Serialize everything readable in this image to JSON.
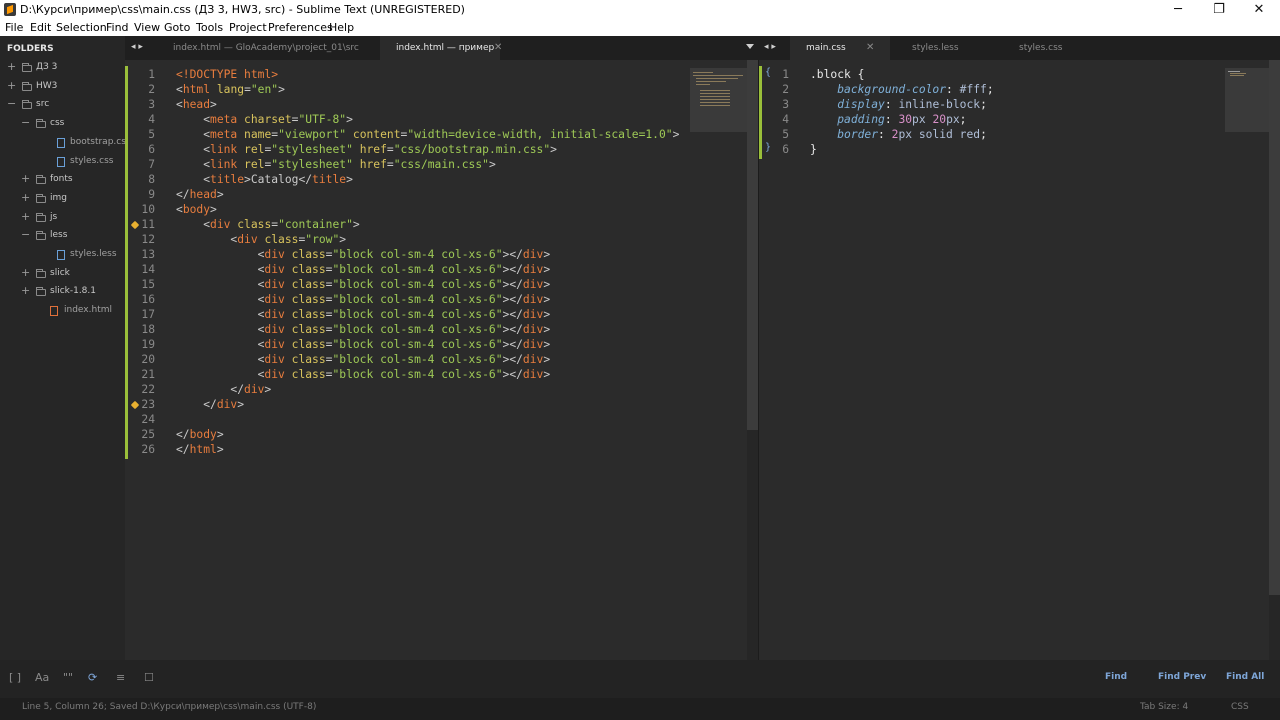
{
  "window": {
    "title": "D:\\Курси\\пример\\css\\main.css (ДЗ 3, HW3, src) - Sublime Text (UNREGISTERED)",
    "minimize": "─",
    "maximize": "❐",
    "close": "✕"
  },
  "menu": [
    "File",
    "Edit",
    "Selection",
    "Find",
    "View",
    "Goto",
    "Tools",
    "Project",
    "Preferences",
    "Help"
  ],
  "sidebar": {
    "header": "FOLDERS",
    "items": [
      {
        "label": "ДЗ 3",
        "type": "folder",
        "depth": 0,
        "toggle": "+"
      },
      {
        "label": "HW3",
        "type": "folder",
        "depth": 0,
        "toggle": "+"
      },
      {
        "label": "src",
        "type": "folder",
        "depth": 0,
        "toggle": "−"
      },
      {
        "label": "css",
        "type": "folder",
        "depth": 1,
        "toggle": "−"
      },
      {
        "label": "bootstrap.css",
        "type": "file",
        "depth": 2,
        "toggle": ""
      },
      {
        "label": "styles.css",
        "type": "file",
        "depth": 2,
        "toggle": ""
      },
      {
        "label": "fonts",
        "type": "folder",
        "depth": 1,
        "toggle": "+"
      },
      {
        "label": "img",
        "type": "folder",
        "depth": 1,
        "toggle": "+"
      },
      {
        "label": "js",
        "type": "folder",
        "depth": 1,
        "toggle": "+"
      },
      {
        "label": "less",
        "type": "folder",
        "depth": 1,
        "toggle": "−"
      },
      {
        "label": "styles.less",
        "type": "file",
        "depth": 2,
        "toggle": ""
      },
      {
        "label": "slick",
        "type": "folder",
        "depth": 1,
        "toggle": "+"
      },
      {
        "label": "slick-1.8.1",
        "type": "folder",
        "depth": 1,
        "toggle": "+"
      },
      {
        "label": "index.html",
        "type": "htmlfile",
        "depth": 1,
        "toggle": ""
      }
    ]
  },
  "left_pane": {
    "nav": "◂ ▸",
    "tabs": [
      {
        "label": "index.html — GloAcademy\\project_01\\src",
        "active": false
      },
      {
        "label": "index.html — пример",
        "active": true,
        "close": "✕"
      }
    ],
    "lines": [
      {
        "n": "1",
        "tokens": [
          [
            "t-doc",
            "<!DOCTYPE "
          ],
          [
            "t-tag",
            "html"
          ],
          [
            "t-doc",
            ">"
          ]
        ]
      },
      {
        "n": "2",
        "tokens": [
          [
            "t-punc",
            "<"
          ],
          [
            "t-tag",
            "html"
          ],
          [
            "t-punc",
            " "
          ],
          [
            "t-attr",
            "lang"
          ],
          [
            "t-punc",
            "="
          ],
          [
            "t-str",
            "\"en\""
          ],
          [
            "t-punc",
            ">"
          ]
        ]
      },
      {
        "n": "3",
        "tokens": [
          [
            "t-punc",
            "<"
          ],
          [
            "t-tag",
            "head"
          ],
          [
            "t-punc",
            ">"
          ]
        ]
      },
      {
        "n": "4",
        "tokens": [
          [
            "t-punc",
            "    <"
          ],
          [
            "t-tag",
            "meta"
          ],
          [
            "t-punc",
            " "
          ],
          [
            "t-attr",
            "charset"
          ],
          [
            "t-punc",
            "="
          ],
          [
            "t-str",
            "\"UTF-8\""
          ],
          [
            "t-punc",
            ">"
          ]
        ]
      },
      {
        "n": "5",
        "tokens": [
          [
            "t-punc",
            "    <"
          ],
          [
            "t-tag",
            "meta"
          ],
          [
            "t-punc",
            " "
          ],
          [
            "t-attr",
            "name"
          ],
          [
            "t-punc",
            "="
          ],
          [
            "t-str",
            "\"viewport\""
          ],
          [
            "t-punc",
            " "
          ],
          [
            "t-attr",
            "content"
          ],
          [
            "t-punc",
            "="
          ],
          [
            "t-str",
            "\"width=device-width, initial-scale=1.0\""
          ],
          [
            "t-punc",
            ">"
          ]
        ]
      },
      {
        "n": "6",
        "tokens": [
          [
            "t-punc",
            "    <"
          ],
          [
            "t-tag",
            "link"
          ],
          [
            "t-punc",
            " "
          ],
          [
            "t-attr",
            "rel"
          ],
          [
            "t-punc",
            "="
          ],
          [
            "t-str",
            "\"stylesheet\""
          ],
          [
            "t-punc",
            " "
          ],
          [
            "t-attr",
            "href"
          ],
          [
            "t-punc",
            "="
          ],
          [
            "t-str",
            "\"css/bootstrap.min.css\""
          ],
          [
            "t-punc",
            ">"
          ]
        ]
      },
      {
        "n": "7",
        "tokens": [
          [
            "t-punc",
            "    <"
          ],
          [
            "t-tag",
            "link"
          ],
          [
            "t-punc",
            " "
          ],
          [
            "t-attr",
            "rel"
          ],
          [
            "t-punc",
            "="
          ],
          [
            "t-str",
            "\"stylesheet\""
          ],
          [
            "t-punc",
            " "
          ],
          [
            "t-attr",
            "href"
          ],
          [
            "t-punc",
            "="
          ],
          [
            "t-str",
            "\"css/main.css\""
          ],
          [
            "t-punc",
            ">"
          ]
        ]
      },
      {
        "n": "8",
        "tokens": [
          [
            "t-punc",
            "    <"
          ],
          [
            "t-tag",
            "title"
          ],
          [
            "t-punc",
            ">Catalog</"
          ],
          [
            "t-tag",
            "title"
          ],
          [
            "t-punc",
            ">"
          ]
        ]
      },
      {
        "n": "9",
        "tokens": [
          [
            "t-punc",
            "</"
          ],
          [
            "t-tag",
            "head"
          ],
          [
            "t-punc",
            ">"
          ]
        ]
      },
      {
        "n": "10",
        "tokens": [
          [
            "t-punc",
            "<"
          ],
          [
            "t-tag",
            "body"
          ],
          [
            "t-punc",
            ">"
          ]
        ]
      },
      {
        "n": "11",
        "marker": true,
        "tokens": [
          [
            "t-punc",
            "    <"
          ],
          [
            "t-tag",
            "div"
          ],
          [
            "t-punc",
            " "
          ],
          [
            "t-attr",
            "class"
          ],
          [
            "t-punc",
            "="
          ],
          [
            "t-str",
            "\"container\""
          ],
          [
            "t-punc",
            ">"
          ]
        ]
      },
      {
        "n": "12",
        "tokens": [
          [
            "t-punc",
            "        <"
          ],
          [
            "t-tag",
            "div"
          ],
          [
            "t-punc",
            " "
          ],
          [
            "t-attr",
            "class"
          ],
          [
            "t-punc",
            "="
          ],
          [
            "t-str",
            "\"row\""
          ],
          [
            "t-punc",
            ">"
          ]
        ]
      },
      {
        "n": "13",
        "tokens": [
          [
            "t-punc",
            "            <"
          ],
          [
            "t-tag",
            "div"
          ],
          [
            "t-punc",
            " "
          ],
          [
            "t-attr",
            "class"
          ],
          [
            "t-punc",
            "="
          ],
          [
            "t-str",
            "\"block col-sm-4 col-xs-6\""
          ],
          [
            "t-punc",
            "></"
          ],
          [
            "t-tag",
            "div"
          ],
          [
            "t-punc",
            ">"
          ]
        ]
      },
      {
        "n": "14",
        "tokens": [
          [
            "t-punc",
            "            <"
          ],
          [
            "t-tag",
            "div"
          ],
          [
            "t-punc",
            " "
          ],
          [
            "t-attr",
            "class"
          ],
          [
            "t-punc",
            "="
          ],
          [
            "t-str",
            "\"block col-sm-4 col-xs-6\""
          ],
          [
            "t-punc",
            "></"
          ],
          [
            "t-tag",
            "div"
          ],
          [
            "t-punc",
            ">"
          ]
        ]
      },
      {
        "n": "15",
        "tokens": [
          [
            "t-punc",
            "            <"
          ],
          [
            "t-tag",
            "div"
          ],
          [
            "t-punc",
            " "
          ],
          [
            "t-attr",
            "class"
          ],
          [
            "t-punc",
            "="
          ],
          [
            "t-str",
            "\"block col-sm-4 col-xs-6\""
          ],
          [
            "t-punc",
            "></"
          ],
          [
            "t-tag",
            "div"
          ],
          [
            "t-punc",
            ">"
          ]
        ]
      },
      {
        "n": "16",
        "tokens": [
          [
            "t-punc",
            "            <"
          ],
          [
            "t-tag",
            "div"
          ],
          [
            "t-punc",
            " "
          ],
          [
            "t-attr",
            "class"
          ],
          [
            "t-punc",
            "="
          ],
          [
            "t-str",
            "\"block col-sm-4 col-xs-6\""
          ],
          [
            "t-punc",
            "></"
          ],
          [
            "t-tag",
            "div"
          ],
          [
            "t-punc",
            ">"
          ]
        ]
      },
      {
        "n": "17",
        "tokens": [
          [
            "t-punc",
            "            <"
          ],
          [
            "t-tag",
            "div"
          ],
          [
            "t-punc",
            " "
          ],
          [
            "t-attr",
            "class"
          ],
          [
            "t-punc",
            "="
          ],
          [
            "t-str",
            "\"block col-sm-4 col-xs-6\""
          ],
          [
            "t-punc",
            "></"
          ],
          [
            "t-tag",
            "div"
          ],
          [
            "t-punc",
            ">"
          ]
        ]
      },
      {
        "n": "18",
        "tokens": [
          [
            "t-punc",
            "            <"
          ],
          [
            "t-tag",
            "div"
          ],
          [
            "t-punc",
            " "
          ],
          [
            "t-attr",
            "class"
          ],
          [
            "t-punc",
            "="
          ],
          [
            "t-str",
            "\"block col-sm-4 col-xs-6\""
          ],
          [
            "t-punc",
            "></"
          ],
          [
            "t-tag",
            "div"
          ],
          [
            "t-punc",
            ">"
          ]
        ]
      },
      {
        "n": "19",
        "tokens": [
          [
            "t-punc",
            "            <"
          ],
          [
            "t-tag",
            "div"
          ],
          [
            "t-punc",
            " "
          ],
          [
            "t-attr",
            "class"
          ],
          [
            "t-punc",
            "="
          ],
          [
            "t-str",
            "\"block col-sm-4 col-xs-6\""
          ],
          [
            "t-punc",
            "></"
          ],
          [
            "t-tag",
            "div"
          ],
          [
            "t-punc",
            ">"
          ]
        ]
      },
      {
        "n": "20",
        "tokens": [
          [
            "t-punc",
            "            <"
          ],
          [
            "t-tag",
            "div"
          ],
          [
            "t-punc",
            " "
          ],
          [
            "t-attr",
            "class"
          ],
          [
            "t-punc",
            "="
          ],
          [
            "t-str",
            "\"block col-sm-4 col-xs-6\""
          ],
          [
            "t-punc",
            "></"
          ],
          [
            "t-tag",
            "div"
          ],
          [
            "t-punc",
            ">"
          ]
        ]
      },
      {
        "n": "21",
        "tokens": [
          [
            "t-punc",
            "            <"
          ],
          [
            "t-tag",
            "div"
          ],
          [
            "t-punc",
            " "
          ],
          [
            "t-attr",
            "class"
          ],
          [
            "t-punc",
            "="
          ],
          [
            "t-str",
            "\"block col-sm-4 col-xs-6\""
          ],
          [
            "t-punc",
            "></"
          ],
          [
            "t-tag",
            "div"
          ],
          [
            "t-punc",
            ">"
          ]
        ]
      },
      {
        "n": "22",
        "tokens": [
          [
            "t-punc",
            "        </"
          ],
          [
            "t-tag",
            "div"
          ],
          [
            "t-punc",
            ">"
          ]
        ]
      },
      {
        "n": "23",
        "marker": true,
        "tokens": [
          [
            "t-punc",
            "    </"
          ],
          [
            "t-tag",
            "div"
          ],
          [
            "t-punc",
            ">"
          ]
        ]
      },
      {
        "n": "24",
        "tokens": []
      },
      {
        "n": "25",
        "tokens": [
          [
            "t-punc",
            "</"
          ],
          [
            "t-tag",
            "body"
          ],
          [
            "t-punc",
            ">"
          ]
        ]
      },
      {
        "n": "26",
        "tokens": [
          [
            "t-punc",
            "</"
          ],
          [
            "t-tag",
            "html"
          ],
          [
            "t-punc",
            ">"
          ]
        ]
      }
    ]
  },
  "right_pane": {
    "nav": "◂ ▸",
    "tabs": [
      {
        "label": "main.css",
        "active": true,
        "close": "✕"
      },
      {
        "label": "styles.less",
        "active": false
      },
      {
        "label": "styles.css",
        "active": false
      }
    ],
    "fold_open": "{",
    "fold_close": "}",
    "lines": [
      {
        "n": "1",
        "tokens": [
          [
            "t-sel",
            ".block "
          ],
          [
            "t-brace",
            "{"
          ]
        ]
      },
      {
        "n": "2",
        "tokens": [
          [
            "t-sel",
            "    "
          ],
          [
            "t-prop",
            "background-color"
          ],
          [
            "t-sel",
            ": "
          ],
          [
            "t-val",
            "#fff"
          ],
          [
            "t-sel",
            ";"
          ]
        ]
      },
      {
        "n": "3",
        "tokens": [
          [
            "t-sel",
            "    "
          ],
          [
            "t-prop",
            "display"
          ],
          [
            "t-sel",
            ": "
          ],
          [
            "t-val",
            "inline-block"
          ],
          [
            "t-sel",
            ";"
          ]
        ]
      },
      {
        "n": "4",
        "tokens": [
          [
            "t-sel",
            "    "
          ],
          [
            "t-prop",
            "padding"
          ],
          [
            "t-sel",
            ": "
          ],
          [
            "t-num",
            "30"
          ],
          [
            "t-val",
            "px "
          ],
          [
            "t-num",
            "20"
          ],
          [
            "t-val",
            "px"
          ],
          [
            "t-sel",
            ";"
          ]
        ]
      },
      {
        "n": "5",
        "tokens": [
          [
            "t-sel",
            "    "
          ],
          [
            "t-prop",
            "border"
          ],
          [
            "t-sel",
            ": "
          ],
          [
            "t-num",
            "2"
          ],
          [
            "t-val",
            "px solid red"
          ],
          [
            "t-sel",
            ";"
          ]
        ]
      },
      {
        "n": "6",
        "tokens": [
          [
            "t-brace",
            "}"
          ]
        ]
      }
    ]
  },
  "findbar": {
    "icons": [
      "regex-icon",
      "case-icon",
      "word-icon",
      "wrap-icon",
      "selection-icon",
      "highlight-icon"
    ],
    "icon_glyphs": [
      "[ ]",
      "Aa",
      "\"\"",
      "⟳",
      "≡",
      "☐"
    ],
    "find": "Find",
    "find_prev": "Find Prev",
    "find_all": "Find All"
  },
  "status": {
    "left": "Line 5, Column 26; Saved D:\\Курси\\пример\\css\\main.css (UTF-8)",
    "tab_size": "Tab Size: 4",
    "syntax": "CSS"
  },
  "colors": {
    "accent_gutter": "#9abf3a",
    "find_buttons": "#7ea6d8",
    "background": "#2b2b2b"
  }
}
